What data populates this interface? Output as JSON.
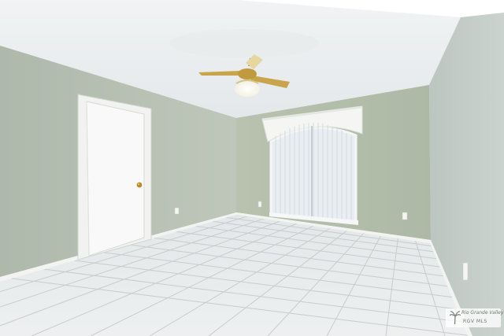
{
  "scene": {
    "description_free": true,
    "colors": {
      "ceiling": "#eef1f2",
      "wall_left": "#b9c2b6",
      "wall_back": "#b3bea9",
      "wall_right": "#c4cdc8",
      "floor": "#e8ebeb",
      "grout": "#c9cdcd",
      "trim": "#f4f5f3",
      "fan_blade": "#c8a44a",
      "window_glass": "#e9eef3"
    },
    "icons": [
      "ceiling-fan-icon",
      "door-knob-icon",
      "outlet-icon",
      "palm-tree-icon"
    ]
  },
  "watermark": {
    "brand": "Rio Grande Valley",
    "sub": "RGV MLS"
  }
}
